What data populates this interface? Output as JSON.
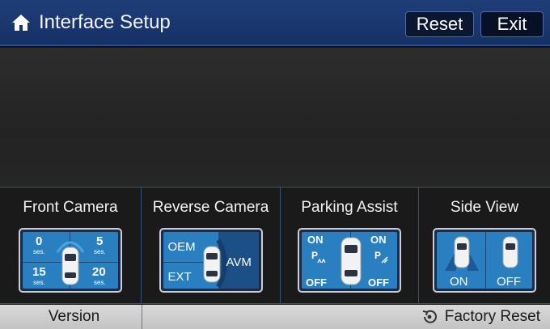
{
  "header": {
    "title": "Interface Setup",
    "icon": "home-icon",
    "reset_label": "Reset",
    "exit_label": "Exit"
  },
  "panels": [
    {
      "label": "Front Camera",
      "tile": {
        "tl": "0",
        "tr": "5",
        "bl": "15",
        "br": "20",
        "unit": "ses."
      }
    },
    {
      "label": "Reverse Camera",
      "tile": {
        "top_left": "OEM",
        "bottom_left": "EXT",
        "right": "AVM"
      }
    },
    {
      "label": "Parking Assist",
      "tile": {
        "on_left": "ON",
        "on_right": "ON",
        "off_left": "OFF",
        "off_right": "OFF"
      }
    },
    {
      "label": "Side View",
      "tile": {
        "on": "ON",
        "off": "OFF"
      }
    }
  ],
  "footer": {
    "version_label": "Version",
    "factory_reset_label": "Factory Reset",
    "factory_icon": "restore-icon"
  },
  "colors": {
    "header_bg": "#1a3670",
    "tile_blue": "#2a7fc0",
    "footer_bg": "#cfcfcf"
  }
}
